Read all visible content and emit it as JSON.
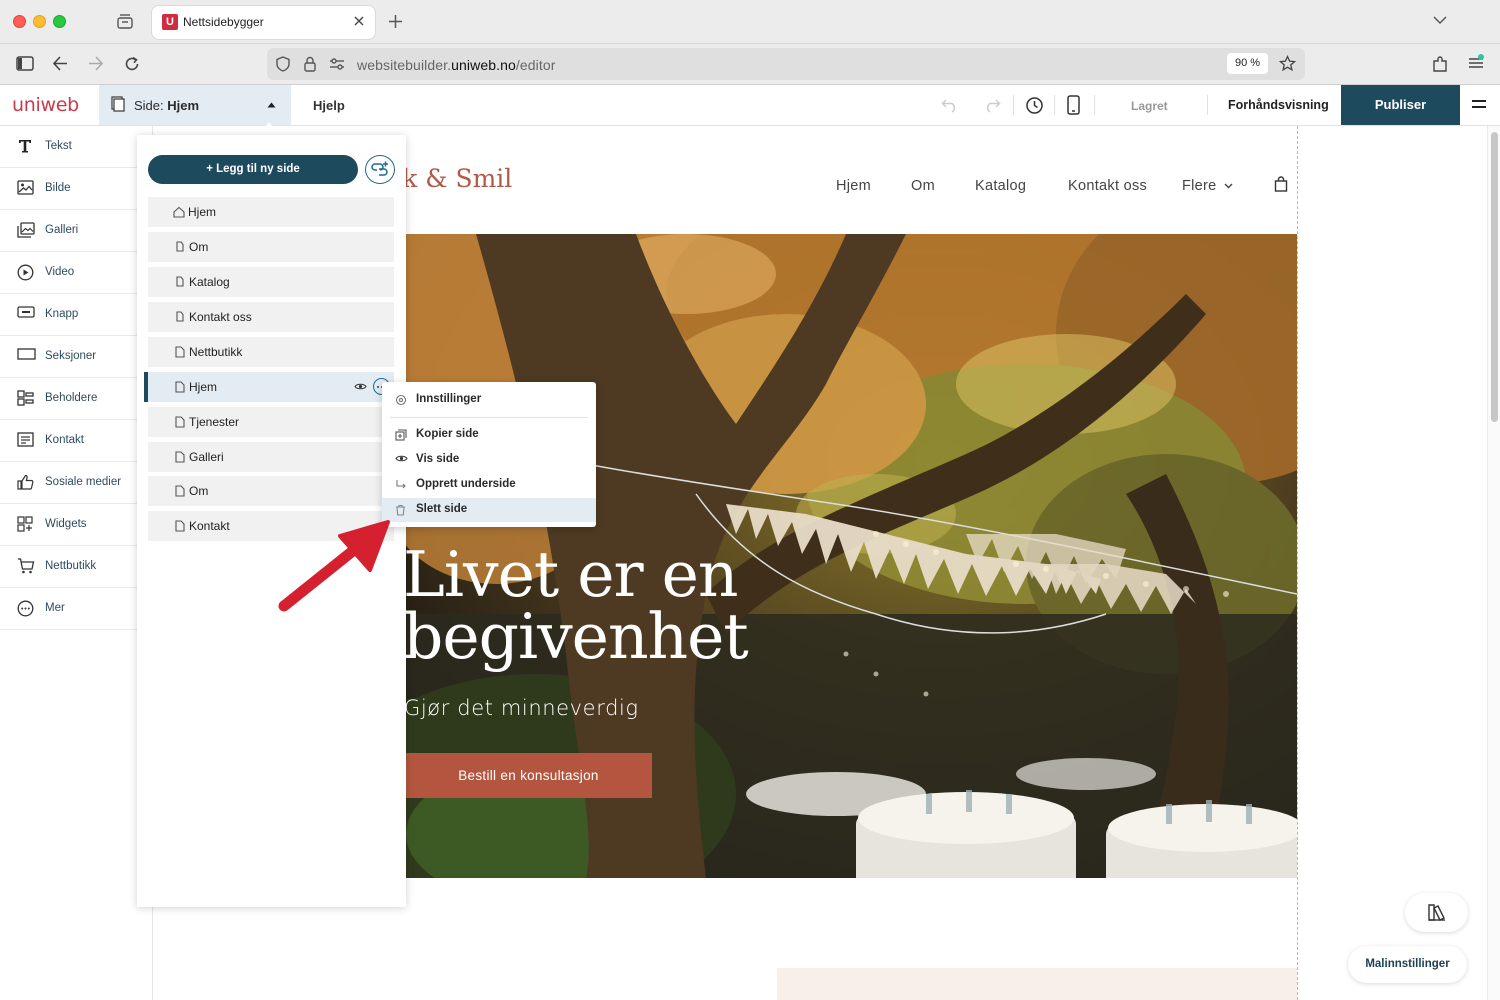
{
  "browser": {
    "tab_title": "Nettsidebygger",
    "favicon_letter": "U",
    "url_prefix": "websitebuilder.",
    "url_domain": "uniweb.no",
    "url_path": "/editor",
    "zoom": "90 %"
  },
  "editor": {
    "logo": "uniweb",
    "page_selector_prefix": "Side:",
    "page_selector_value": "Hjem",
    "help": "Hjelp",
    "saved_status": "Lagret",
    "preview": "Forhåndsvisning",
    "publish": "Publiser",
    "template_settings": "Malinnstillinger"
  },
  "sidebar": {
    "items": [
      {
        "label": "Tekst",
        "icon": "text-icon"
      },
      {
        "label": "Bilde",
        "icon": "image-icon"
      },
      {
        "label": "Galleri",
        "icon": "gallery-icon"
      },
      {
        "label": "Video",
        "icon": "video-icon"
      },
      {
        "label": "Knapp",
        "icon": "button-icon"
      },
      {
        "label": "Seksjoner",
        "icon": "sections-icon"
      },
      {
        "label": "Beholdere",
        "icon": "containers-icon"
      },
      {
        "label": "Kontakt",
        "icon": "contact-form-icon"
      },
      {
        "label": "Sosiale medier",
        "icon": "thumbs-up-icon"
      },
      {
        "label": "Widgets",
        "icon": "widgets-icon"
      },
      {
        "label": "Nettbutikk",
        "icon": "cart-icon"
      },
      {
        "label": "Mer",
        "icon": "more-icon"
      }
    ]
  },
  "pages_panel": {
    "add_page": "+ Legg til ny side",
    "pages": [
      {
        "label": "Hjem",
        "icon": "home-icon"
      },
      {
        "label": "Om",
        "icon": "subpage-icon"
      },
      {
        "label": "Katalog",
        "icon": "subpage-icon"
      },
      {
        "label": "Kontakt oss",
        "icon": "subpage-icon"
      },
      {
        "label": "Nettbutikk",
        "icon": "page-icon"
      },
      {
        "label": "Hjem",
        "icon": "page-icon"
      },
      {
        "label": "Tjenester",
        "icon": "page-icon"
      },
      {
        "label": "Galleri",
        "icon": "page-icon"
      },
      {
        "label": "Om",
        "icon": "page-icon"
      },
      {
        "label": "Kontakt",
        "icon": "page-icon"
      }
    ]
  },
  "context_menu": {
    "settings": "Innstillinger",
    "copy_page": "Kopier side",
    "view_page": "Vis side",
    "create_subpage": "Opprett underside",
    "delete_page": "Slett side"
  },
  "site": {
    "name": "kk & Smil",
    "nav": [
      "Hjem",
      "Om",
      "Katalog",
      "Kontakt oss",
      "Flere"
    ],
    "hero_title_line1": "Livet er en",
    "hero_title_line2": "begivenhet",
    "hero_subtitle": "Gjør det minneverdig",
    "hero_cta": "Bestill en konsultasjon"
  },
  "colors": {
    "accent": "#1e4a5e",
    "brand": "#c93b4a",
    "site_accent": "#b4563f",
    "annotation": "#d4202f"
  }
}
